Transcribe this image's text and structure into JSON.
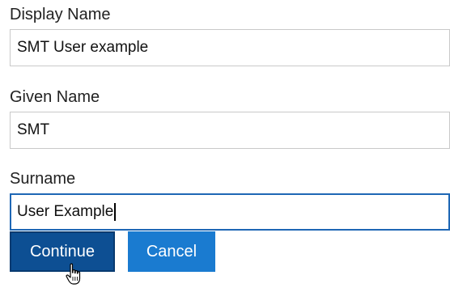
{
  "form": {
    "fields": [
      {
        "label": "Display Name",
        "value": "SMT User example",
        "focused": false
      },
      {
        "label": "Given Name",
        "value": "SMT",
        "focused": false
      },
      {
        "label": "Surname",
        "value": "User Example",
        "focused": true
      }
    ]
  },
  "actions": {
    "continue_label": "Continue",
    "cancel_label": "Cancel"
  },
  "colors": {
    "continue_bg": "#0d4f93",
    "cancel_bg": "#1a7bd0",
    "focus_border": "#1e67b5"
  },
  "pointer": {
    "icon": "hand-pointer-icon"
  }
}
